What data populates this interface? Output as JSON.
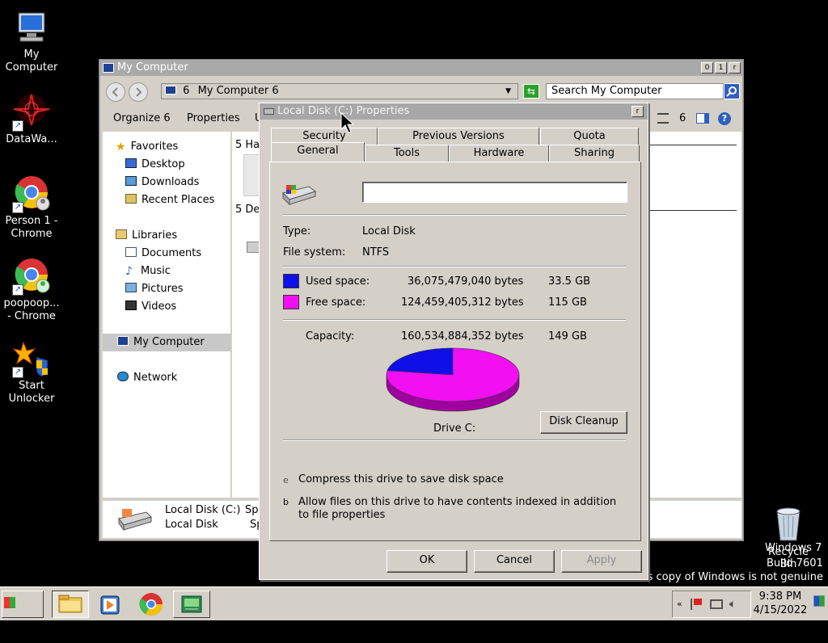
{
  "desktop": {
    "icons": [
      {
        "label": "My\nComputer",
        "icon": "computer-icon"
      },
      {
        "label": "DataWa...",
        "icon": "datawarp-icon"
      },
      {
        "label": "Person 1 -\nChrome",
        "icon": "chrome-icon"
      },
      {
        "label": "poopoop...\n- Chrome",
        "icon": "chrome-icon"
      },
      {
        "label": "Start\nUnlocker",
        "icon": "unlocker-icon"
      },
      {
        "label": "Recycle\nBin",
        "icon": "recycle-bin-icon"
      }
    ],
    "watermark": {
      "line1": "Windows 7",
      "line2": "Build 7601",
      "line3": "This copy of Windows is not genuine"
    }
  },
  "explorer": {
    "title": "My Computer",
    "controls": [
      "0",
      "1",
      "r"
    ],
    "address_prefix": "6",
    "address_text": "My Computer 6",
    "search_placeholder": "Search My Computer",
    "toolbar": {
      "organize": "Organize 6",
      "properties": "Properties",
      "more": "U",
      "view_num": "6"
    },
    "nav": {
      "favorites": "Favorites",
      "desktop": "Desktop",
      "downloads": "Downloads",
      "recent": "Recent Places",
      "libraries": "Libraries",
      "documents": "Documents",
      "music": "Music",
      "pictures": "Pictures",
      "videos": "Videos",
      "mycomputer": "My Computer",
      "network": "Network"
    },
    "groups": {
      "hard": "5 Ha",
      "devices": "5 De"
    },
    "details": {
      "name": "Local Disk (C:)",
      "type": "Local Disk",
      "suffix1": "Sp",
      "suffix2": "Sp"
    }
  },
  "dialog": {
    "title": "Local Disk (C:) Properties",
    "close": "r",
    "tabs_back": [
      "Security",
      "Previous Versions",
      "Quota"
    ],
    "tabs_front": [
      "General",
      "Tools",
      "Hardware",
      "Sharing"
    ],
    "drive_label_value": "",
    "type_label": "Type:",
    "type_value": "Local Disk",
    "fs_label": "File system:",
    "fs_value": "NTFS",
    "used_label": "Used space:",
    "used_bytes": "36,075,479,040 bytes",
    "used_gb": "33.5 GB",
    "free_label": "Free space:",
    "free_bytes": "124,459,405,312 bytes",
    "free_gb": "115 GB",
    "cap_label": "Capacity:",
    "cap_bytes": "160,534,884,352 bytes",
    "cap_gb": "149 GB",
    "used_fraction": 0.2247,
    "drive_name": "Drive C:",
    "cleanup": "Disk Cleanup",
    "compress_mark": "e",
    "compress_text": "Compress this drive to save disk space",
    "index_mark": "b",
    "index_text": "Allow files on this drive to have contents indexed in addition",
    "index_text2": "to file properties",
    "ok": "OK",
    "cancel": "Cancel",
    "apply": "Apply",
    "colors": {
      "used": "#0f0fe8",
      "free": "#f20ff2"
    }
  },
  "taskbar": {
    "start": "Start",
    "time": "9:38 PM",
    "date": "4/15/2022"
  }
}
